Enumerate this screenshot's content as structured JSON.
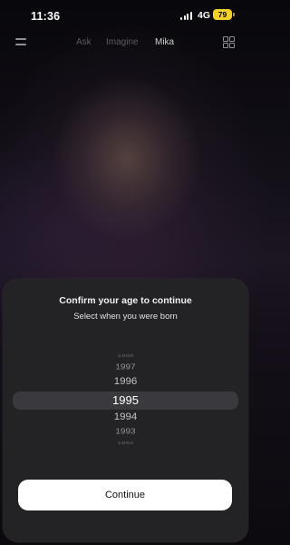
{
  "status_bar": {
    "time": "11:36",
    "network": "4G",
    "battery": "79",
    "battery_color": "#f3d12a"
  },
  "top_nav": {
    "menu_icon": "menu-icon",
    "tabs": [
      {
        "label": "Ask",
        "active": false
      },
      {
        "label": "Imagine",
        "active": false
      },
      {
        "label": "Mika",
        "active": true
      }
    ],
    "grid_icon": "grid-icon"
  },
  "age_sheet": {
    "title": "Confirm your age to continue",
    "subtitle": "Select when you were born",
    "years": [
      "1998",
      "1997",
      "1996",
      "1995",
      "1994",
      "1993",
      "1992"
    ],
    "selected_year": "1995",
    "continue_label": "Continue"
  },
  "colors": {
    "sheet_background": "#232225",
    "picker_highlight": "#3a393d",
    "button_background": "#ffffff"
  }
}
